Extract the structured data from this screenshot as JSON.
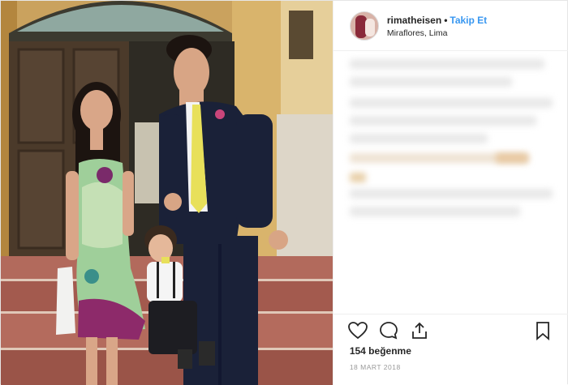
{
  "post": {
    "username": "rimatheisen",
    "separator": "•",
    "follow_label": "Takip Et",
    "location": "Miraflores, Lima",
    "likes": "154 beğenme",
    "date": "18 MART 2018"
  },
  "icons": {
    "like": "heart-icon",
    "comment": "comment-icon",
    "share": "share-icon",
    "save": "bookmark-icon"
  },
  "colors": {
    "follow": "#3897f0",
    "text": "#262626",
    "muted": "#999999"
  }
}
